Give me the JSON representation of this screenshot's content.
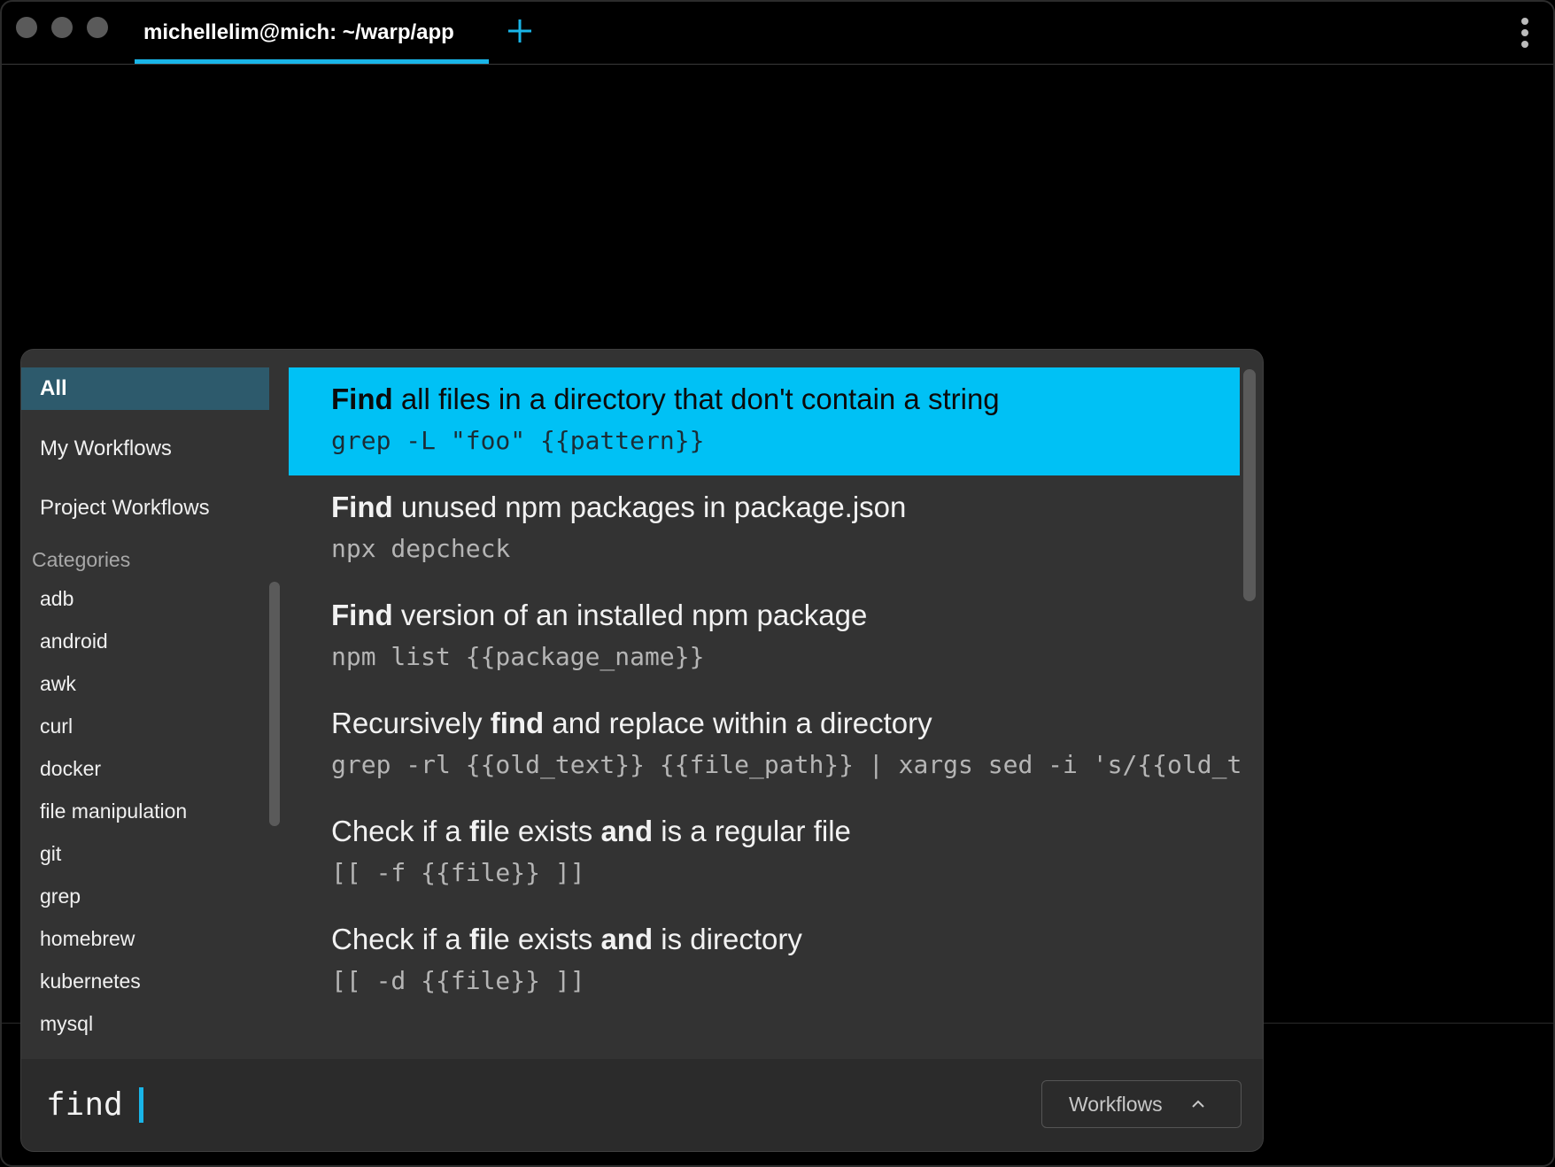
{
  "titlebar": {
    "tab_title": "michellelim@mich: ~/warp/app",
    "new_tab_icon": "plus-icon",
    "menu_icon": "kebab-menu-icon",
    "accent_color": "#19b5e8"
  },
  "sidebar": {
    "items": [
      {
        "label": "All",
        "active": true
      },
      {
        "label": "My Workflows",
        "active": false
      },
      {
        "label": "Project Workflows",
        "active": false
      }
    ],
    "categories_header": "Categories",
    "categories": [
      "adb",
      "android",
      "awk",
      "curl",
      "docker",
      "file manipulation",
      "git",
      "grep",
      "homebrew",
      "kubernetes",
      "mysql"
    ]
  },
  "results": [
    {
      "title_parts": [
        {
          "text": "Find",
          "bold": true
        },
        {
          "text": " all files in a directory that don't contain a string",
          "bold": false
        }
      ],
      "command": "grep -L \"foo\" {{pattern}}",
      "selected": true
    },
    {
      "title_parts": [
        {
          "text": "Find",
          "bold": true
        },
        {
          "text": " unused npm packages in package.json",
          "bold": false
        }
      ],
      "command": "npx depcheck",
      "selected": false
    },
    {
      "title_parts": [
        {
          "text": "Find",
          "bold": true
        },
        {
          "text": " version of an installed npm package",
          "bold": false
        }
      ],
      "command": "npm list {{package_name}}",
      "selected": false
    },
    {
      "title_parts": [
        {
          "text": "Recursively ",
          "bold": false
        },
        {
          "text": "find",
          "bold": true
        },
        {
          "text": " and replace within a directory",
          "bold": false
        }
      ],
      "command": "grep -rl {{old_text}} {{file_path}} | xargs sed -i 's/{{old_t",
      "selected": false
    },
    {
      "title_parts": [
        {
          "text": "Check if a ",
          "bold": false
        },
        {
          "text": "fi",
          "bold": true
        },
        {
          "text": "le exists ",
          "bold": false
        },
        {
          "text": "and",
          "bold": true
        },
        {
          "text": " is a regular file",
          "bold": false
        }
      ],
      "command": "[[ -f {{file}} ]]",
      "selected": false
    },
    {
      "title_parts": [
        {
          "text": "Check if a ",
          "bold": false
        },
        {
          "text": "fi",
          "bold": true
        },
        {
          "text": "le exists ",
          "bold": false
        },
        {
          "text": "and",
          "bold": true
        },
        {
          "text": " is directory",
          "bold": false
        }
      ],
      "command": "[[ -d {{file}} ]]",
      "selected": false
    }
  ],
  "footer": {
    "search_value": "find",
    "mode_label": "Workflows",
    "mode_icon": "chevron-up-icon"
  },
  "colors": {
    "selected_row": "#00c1f5",
    "active_sidebar": "#2d5a6c",
    "panel_bg": "#333333"
  }
}
